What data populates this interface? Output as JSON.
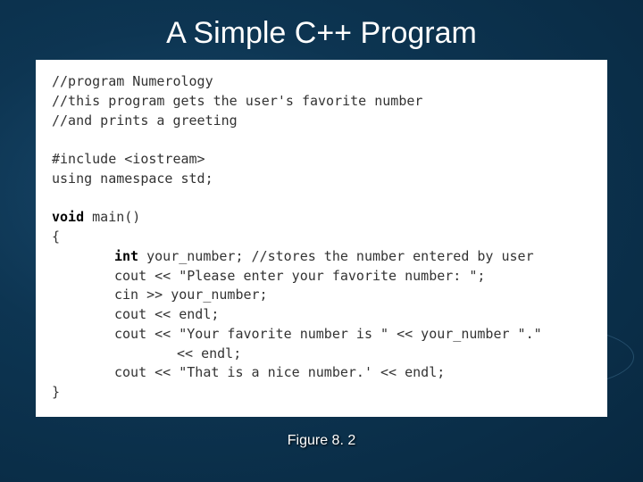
{
  "title": "A Simple C++ Program",
  "caption": "Figure 8. 2",
  "code": {
    "l1": "//program Numerology",
    "l2": "//this program gets the user's favorite number",
    "l3": "//and prints a greeting",
    "l4": "#include <iostream>",
    "l5": "using namespace std;",
    "kw_void": "void",
    "l6b": " main()",
    "l7": "{",
    "kw_int": "int",
    "l8b": " your_number; //stores the number entered by user",
    "l9": "cout << \"Please enter your favorite number: \";",
    "l10": "cin >> your_number;",
    "l11": "cout << endl;",
    "l12": "cout << \"Your favorite number is \" << your_number \".\"",
    "l13": "<< endl;",
    "l14": "cout << \"That is a nice number.' << endl;",
    "l15": "}"
  }
}
